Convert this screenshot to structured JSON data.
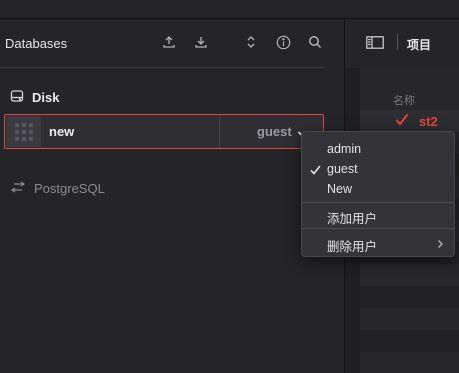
{
  "databases_panel": {
    "title": "Databases",
    "header_icons": [
      "upload-icon",
      "download-icon",
      "sort-icon",
      "info-icon",
      "search-icon"
    ],
    "disk_section": {
      "icon": "disk-icon",
      "label": "Disk"
    },
    "entry": {
      "name": "new",
      "user": "guest"
    },
    "postgres_section": {
      "icon": "connection-arrows-icon",
      "label": "PostgreSQL"
    }
  },
  "project_panel": {
    "title": "项目",
    "column_header": "名称",
    "selected_item": "st2"
  },
  "user_menu": {
    "items": [
      {
        "label": "admin",
        "checked": false
      },
      {
        "label": "guest",
        "checked": true
      },
      {
        "label": "New",
        "checked": false
      }
    ],
    "add_user": "添加用户",
    "delete_user": "删除用户"
  },
  "colors": {
    "accent_red": "#e0473b",
    "panel_bg": "#252529",
    "menu_bg": "#333338"
  }
}
